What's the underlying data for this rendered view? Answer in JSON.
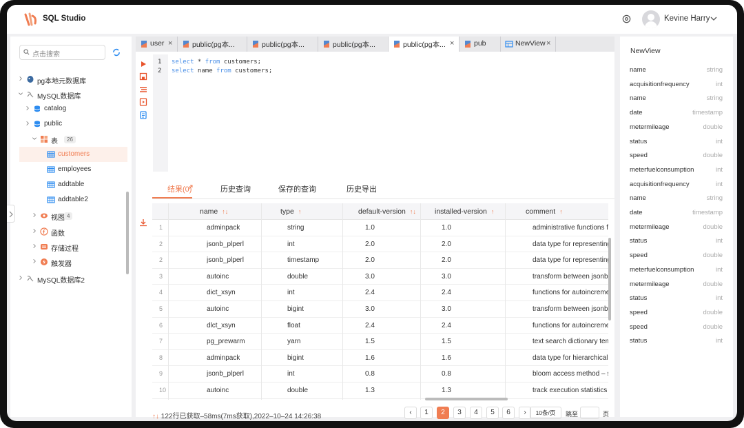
{
  "app": {
    "title": "SQL Studio"
  },
  "user": {
    "name": "Kevine Harry"
  },
  "sidebar": {
    "search_placeholder": "点击搜索",
    "tree": [
      {
        "label": "pg本地元数据库",
        "level": 0,
        "icon": "postgres-icon"
      },
      {
        "label": "MySQL数据库",
        "level": 0,
        "icon": "mysql-icon",
        "expanded": true
      },
      {
        "label": "catalog",
        "level": 1,
        "icon": "database-icon"
      },
      {
        "label": "public",
        "level": 1,
        "icon": "database-icon"
      },
      {
        "label": "表",
        "level": 2,
        "icon": "table-group-icon",
        "count": "26",
        "expanded": true
      },
      {
        "label": "customers",
        "level": 3,
        "icon": "table-icon",
        "selected": true
      },
      {
        "label": "employees",
        "level": 3,
        "icon": "table-icon"
      },
      {
        "label": "addtable",
        "level": 3,
        "icon": "table-icon"
      },
      {
        "label": "addtable2",
        "level": 3,
        "icon": "table-icon"
      },
      {
        "label": "视图",
        "level": 2,
        "icon": "view-icon",
        "count": "4"
      },
      {
        "label": "函数",
        "level": 2,
        "icon": "function-icon"
      },
      {
        "label": "存储过程",
        "level": 2,
        "icon": "procedure-icon"
      },
      {
        "label": "触发器",
        "level": 2,
        "icon": "trigger-icon"
      },
      {
        "label": "MySQL数据库2",
        "level": 0,
        "icon": "mysql-icon"
      }
    ]
  },
  "tabs": [
    {
      "label": "user",
      "close": "×"
    },
    {
      "label": "public(pg本...",
      "close": ""
    },
    {
      "label": "public(pg本...",
      "close": ""
    },
    {
      "label": "public(pg本...",
      "close": ""
    },
    {
      "label": "public(pg本...",
      "close": "×",
      "active": true
    },
    {
      "label": "pub",
      "close": ""
    },
    {
      "label": "NewView",
      "close": "×"
    }
  ],
  "editor": {
    "lines": [
      {
        "n": "1",
        "parts": [
          [
            "kw",
            "select"
          ],
          [
            "t",
            " * "
          ],
          [
            "kw",
            "from"
          ],
          [
            "t",
            " customers;"
          ]
        ]
      },
      {
        "n": "2",
        "parts": [
          [
            "kw",
            "select"
          ],
          [
            "t",
            " name "
          ],
          [
            "kw",
            "from"
          ],
          [
            "t",
            " customers;"
          ]
        ]
      }
    ]
  },
  "results": {
    "tabs": [
      "结果(0)",
      "历史查询",
      "保存的查询",
      "历史导出"
    ],
    "columns": [
      {
        "label": "name",
        "sort": "↑↓",
        "sort_color": "#f07d52"
      },
      {
        "label": "type",
        "sort": "↑",
        "sort_color": "#f07d52"
      },
      {
        "label": "default-version",
        "sort": "↑↓",
        "sort_color": "#f07d52"
      },
      {
        "label": "installed-version",
        "sort": "↑",
        "sort_color": "#f07d52"
      },
      {
        "label": "comment",
        "sort": "↑",
        "sort_color": "#f07d52"
      }
    ],
    "rows": [
      [
        "1",
        "adminpack",
        "string",
        "1.0",
        "1.0",
        " administrative functions fo"
      ],
      [
        "2",
        "jsonb_plperl",
        "int",
        "2.0",
        "2.0",
        "data type for representing"
      ],
      [
        "2",
        "jsonb_plperl",
        "timestamp",
        "2.0",
        "2.0",
        "data type for representing"
      ],
      [
        "3",
        "autoinc",
        "double",
        "3.0",
        "3.0",
        "transform between jsonb a"
      ],
      [
        "4",
        "dict_xsyn",
        "int",
        "2.4",
        "2.4",
        "functions for autoincremen"
      ],
      [
        "5",
        "autoinc",
        "bigint",
        "3.0",
        "3.0",
        "transform between jsonb a"
      ],
      [
        "6",
        "dlct_xsyn",
        "float",
        "2.4",
        "2.4",
        "functions for autoincremen"
      ],
      [
        "7",
        "pg_prewarm",
        "yarn",
        "1.5",
        "1.5",
        "text search dictionary temp"
      ],
      [
        "8",
        "adminpack",
        "bigint",
        "1.6",
        "1.6",
        "data type for hierarchical tr"
      ],
      [
        "9",
        "jsonb_plperl",
        "int",
        "0.8",
        "0.8",
        "bloom access method – sig"
      ],
      [
        "10",
        "autoinc",
        "double",
        "1.3",
        "1.3",
        "track execution statistics o"
      ]
    ],
    "status": "122行已获取–58ms(7ms获取),2022–10–24 14:26:38",
    "status_icon": "↑↓",
    "pagination": {
      "prev": "‹",
      "next": "›",
      "pages": [
        "1",
        "2",
        "3",
        "4",
        "5",
        "6"
      ],
      "active": "2"
    },
    "page_size": "10条/页",
    "jump_label": "跳至",
    "page_label": "页"
  },
  "right_panel": {
    "title": "NewView",
    "fields": [
      [
        "name",
        "string"
      ],
      [
        "acquisitionfrequency",
        "int"
      ],
      [
        "name",
        "string"
      ],
      [
        "date",
        "timestamp"
      ],
      [
        "metermileage",
        "double"
      ],
      [
        "status",
        "int"
      ],
      [
        "speed",
        "double"
      ],
      [
        "meterfuelconsumption",
        "int"
      ],
      [
        "acquisitionfrequency",
        "int"
      ],
      [
        "name",
        "string"
      ],
      [
        "date",
        "timestamp"
      ],
      [
        "metermileage",
        "double"
      ],
      [
        "status",
        "int"
      ],
      [
        "speed",
        "double"
      ],
      [
        "meterfuelconsumption",
        "int"
      ],
      [
        "metermileage",
        "double"
      ],
      [
        "status",
        "int"
      ],
      [
        "speed",
        "double"
      ],
      [
        "speed",
        "double"
      ],
      [
        "status",
        "int"
      ]
    ]
  },
  "colors": {
    "accent": "#f07d52",
    "keyword": "#4a8fe7"
  }
}
